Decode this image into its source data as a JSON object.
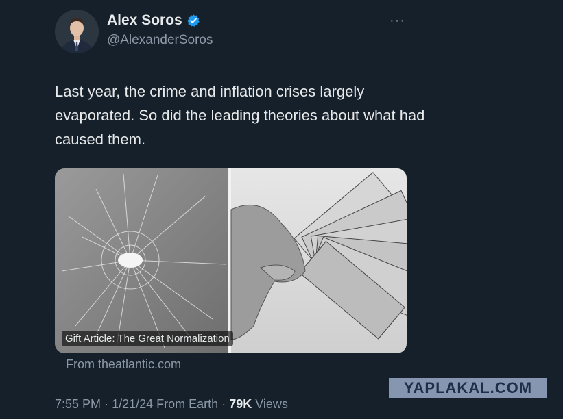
{
  "author": {
    "display_name": "Alex Soros",
    "handle": "@AlexanderSoros",
    "verified": true
  },
  "tweet": {
    "text": "Last year, the crime and inflation crises largely evaporated. So did the leading theories about what had caused them."
  },
  "card": {
    "caption": "Gift Article: The Great Normalization",
    "source": "From theatlantic.com"
  },
  "meta": {
    "time": "7:55 PM",
    "date": "1/21/24",
    "location": "From Earth",
    "views_count": "79K",
    "views_label": "Views"
  },
  "watermark": "YAPLAKAL.COM",
  "icons": {
    "verified": "verified-badge-icon",
    "more": "more-options-icon"
  },
  "colors": {
    "background": "#15202b",
    "verified": "#1d9bf0",
    "secondary_text": "#8b98a5"
  }
}
